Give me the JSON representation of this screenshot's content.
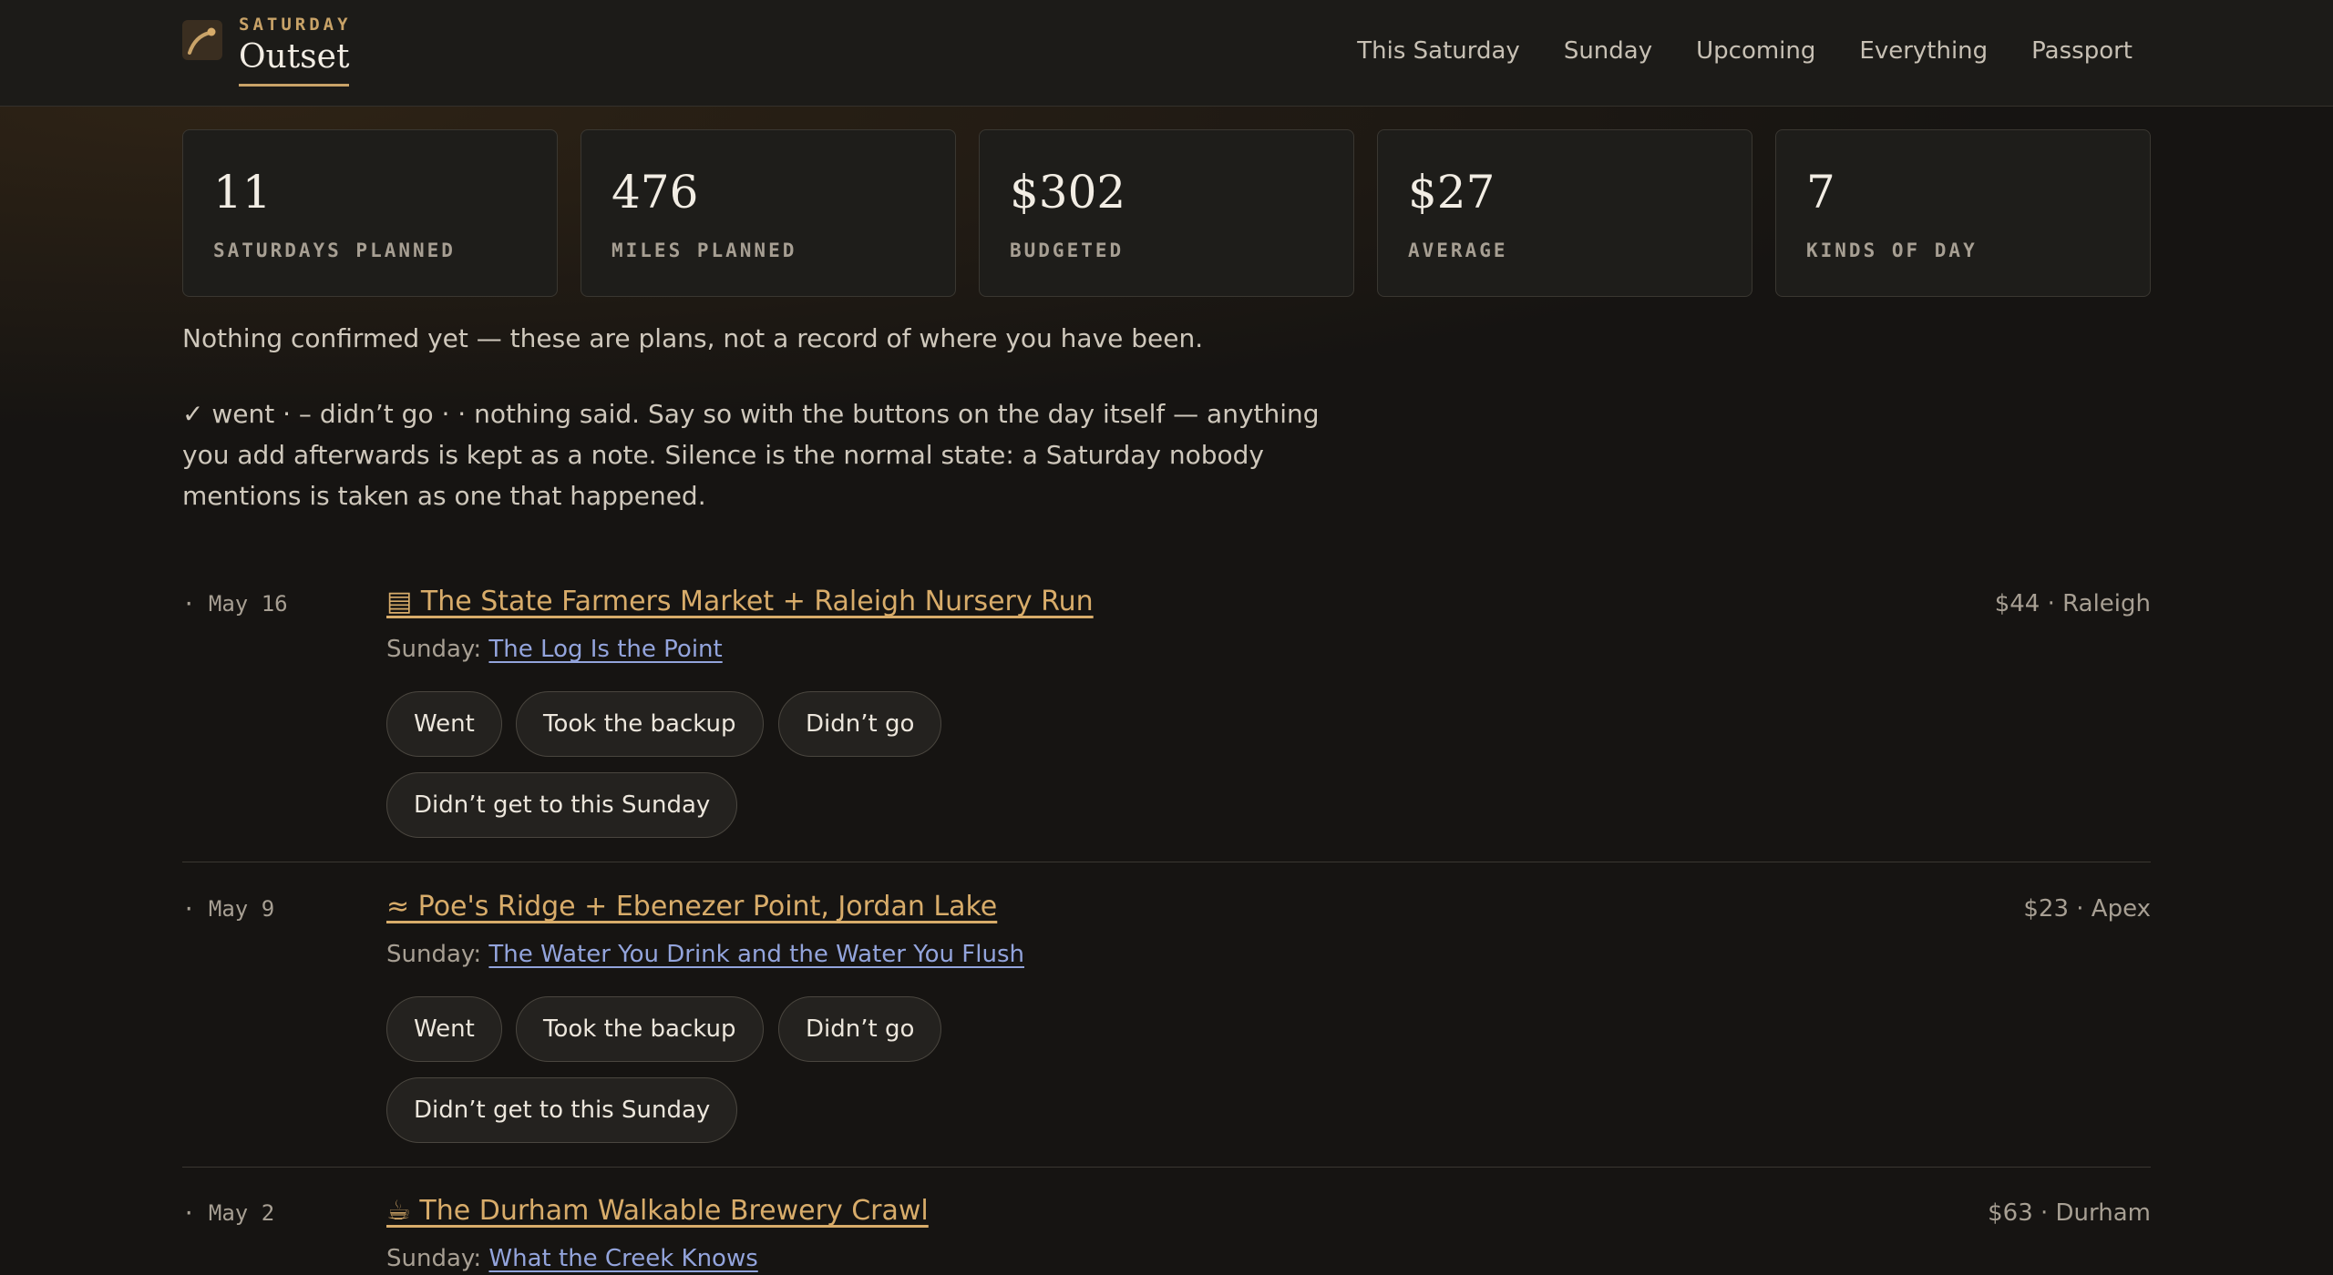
{
  "brand": {
    "kicker": "SATURDAY",
    "name": "Outset"
  },
  "nav": [
    {
      "label": "This Saturday"
    },
    {
      "label": "Sunday"
    },
    {
      "label": "Upcoming"
    },
    {
      "label": "Everything"
    },
    {
      "label": "Passport"
    }
  ],
  "stats": [
    {
      "value": "11",
      "label": "SATURDAYS PLANNED"
    },
    {
      "value": "476",
      "label": "MILES PLANNED"
    },
    {
      "value": "$302",
      "label": "BUDGETED"
    },
    {
      "value": "$27",
      "label": "AVERAGE"
    },
    {
      "value": "7",
      "label": "KINDS OF DAY"
    }
  ],
  "notes": {
    "status": "Nothing confirmed yet — these are plans, not a record of where you have been.",
    "legend": "✓ went · – didn’t go · · nothing said. Say so with the buttons on the day itself — anything you add afterwards is kept as a note. Silence is the normal state: a Saturday nobody mentions is taken as one that happened."
  },
  "entries": [
    {
      "date": "· May 16",
      "title": "▤ The State Farmers Market + Raleigh Nursery Run",
      "meta": "$44 · Raleigh",
      "sunday_label": "Sunday:",
      "sunday_title": "The Log Is the Point",
      "buttons": {
        "went": "Went",
        "backup": "Took the backup",
        "didnt": "Didn’t go",
        "sunday": "Didn’t get to this Sunday"
      }
    },
    {
      "date": "· May 9",
      "title": "≈ Poe's Ridge + Ebenezer Point, Jordan Lake",
      "meta": "$23 · Apex",
      "sunday_label": "Sunday:",
      "sunday_title": "The Water You Drink and the Water You Flush",
      "buttons": {
        "went": "Went",
        "backup": "Took the backup",
        "didnt": "Didn’t go",
        "sunday": "Didn’t get to this Sunday"
      }
    },
    {
      "date": "· May 2",
      "title": "☕ The Durham Walkable Brewery Crawl",
      "meta": "$63 · Durham",
      "sunday_label": "Sunday:",
      "sunday_title": "What the Creek Knows"
    }
  ],
  "colors": {
    "accent": "#d8ac6a",
    "link": "#93a4dc",
    "background": "#161412"
  }
}
